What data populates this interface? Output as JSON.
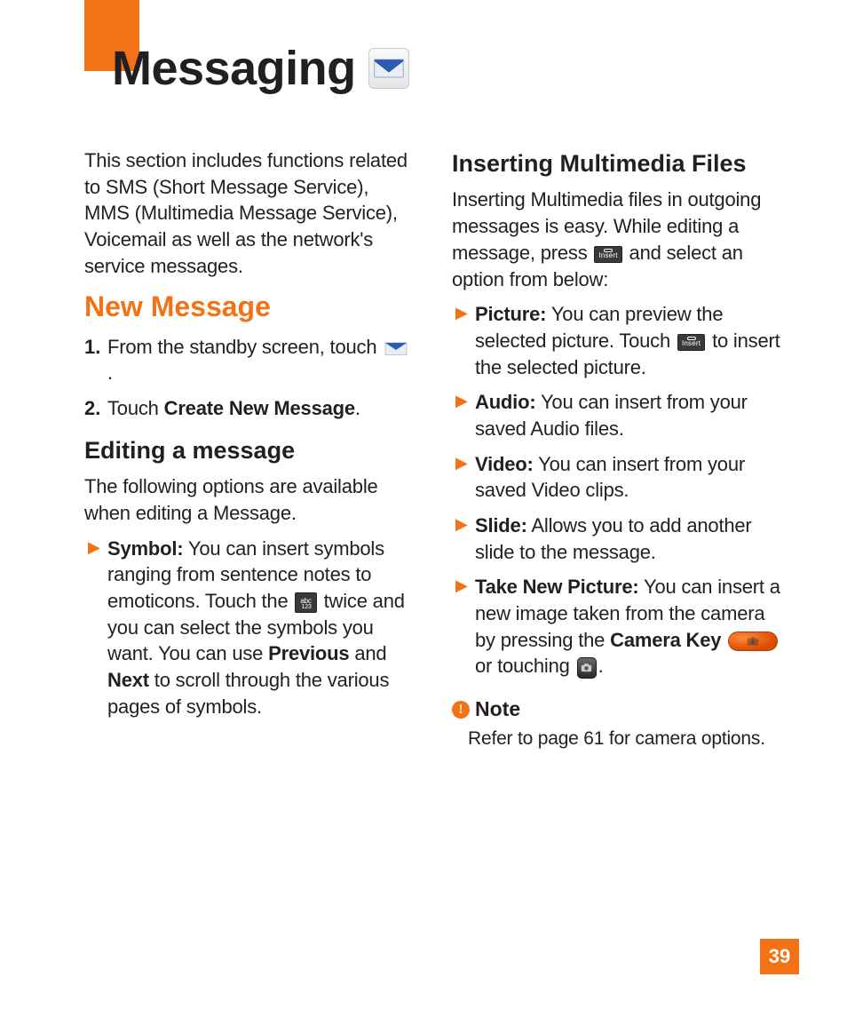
{
  "header": {
    "title": "Messaging"
  },
  "left": {
    "intro": "This section includes functions related to SMS (Short Message Service), MMS (Multimedia Message Service), Voicemail as well as the network's service messages.",
    "h2": "New Message",
    "step1_num": "1.",
    "step1_a": "From the standby screen, touch ",
    "step1_b": ".",
    "step2_num": "2.",
    "step2_a": "Touch ",
    "step2_bold": "Create New Message",
    "step2_b": ".",
    "h3": "Editing a message",
    "edit_intro": "The following options are available when editing a Message.",
    "sym_label": "Symbol:",
    "sym_a": " You can insert symbols ranging from sentence notes to emoticons. Touch the ",
    "sym_b": " twice and you can select the symbols you want. You can use ",
    "sym_prev": "Previous",
    "sym_c": " and ",
    "sym_next": "Next",
    "sym_d": " to scroll through the various pages of symbols."
  },
  "right": {
    "h3": "Inserting Multimedia Files",
    "intro_a": "Inserting Multimedia files in outgoing messages is easy. While editing a message, press ",
    "intro_b": " and select an option from below:",
    "pic_label": "Picture:",
    "pic_a": " You can preview the selected picture. Touch ",
    "pic_b": " to insert the selected picture.",
    "aud_label": "Audio:",
    "aud_a": " You can insert from your saved Audio files.",
    "vid_label": "Video:",
    "vid_a": " You can insert from your saved Video clips.",
    "slide_label": "Slide:",
    "slide_a": " Allows you to add another slide to the message.",
    "tnp_label": "Take New Picture:",
    "tnp_a": " You can insert a new image taken from the camera by pressing the ",
    "tnp_camkey": "Camera Key",
    "tnp_b": " or touching ",
    "tnp_c": ".",
    "note_label": "Note",
    "note_body": "Refer to page 61 for camera options."
  },
  "page_number": "39"
}
